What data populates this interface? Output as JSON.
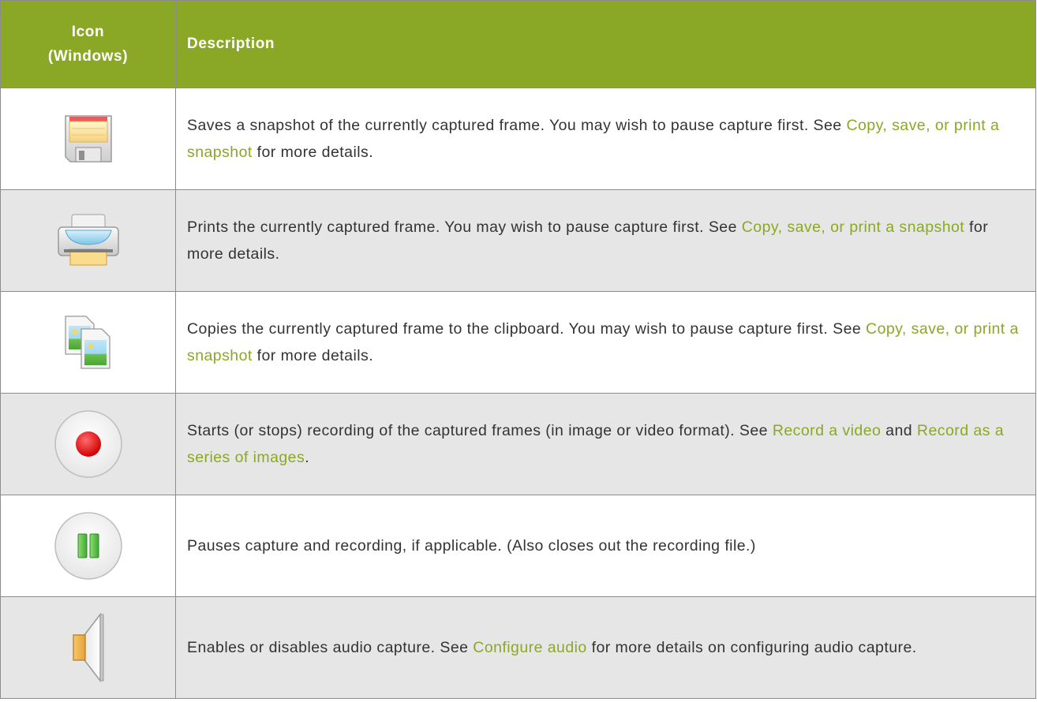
{
  "table": {
    "header": {
      "icon_line1": "Icon",
      "icon_line2": "(Windows)",
      "description": "Description"
    },
    "rows": [
      {
        "icon": "floppy-disk-icon",
        "text1": "Saves a snapshot of the currently captured frame. You may wish to pause capture first. See ",
        "link1": "Copy, save, or print a snapshot",
        "text2": " for more details."
      },
      {
        "icon": "printer-icon",
        "text1": "Prints the currently captured frame. You may wish to pause capture first. See ",
        "link1": "Copy, save, or print a snapshot",
        "text2": " for more details."
      },
      {
        "icon": "copy-images-icon",
        "text1": "Copies the currently captured frame to the clipboard. You may wish to pause capture first. See ",
        "link1": "Copy, save, or print a snapshot",
        "text2": " for more details."
      },
      {
        "icon": "record-icon",
        "text1": "Starts (or stops) recording of the captured frames (in image or video format). See ",
        "link1": "Record a video",
        "text2": " and ",
        "link2": "Record as a series of images",
        "text3": "."
      },
      {
        "icon": "pause-icon",
        "text1": "Pauses capture and recording, if applicable. (Also closes out the recording file.)"
      },
      {
        "icon": "speaker-icon",
        "text1": "Enables or disables audio capture. See ",
        "link1": "Configure audio",
        "text2": " for more details on configuring audio capture."
      }
    ]
  },
  "colors": {
    "header_bg": "#8aa825",
    "link": "#8aa825",
    "row_alt_bg": "#e6e6e6",
    "text": "#333333"
  }
}
